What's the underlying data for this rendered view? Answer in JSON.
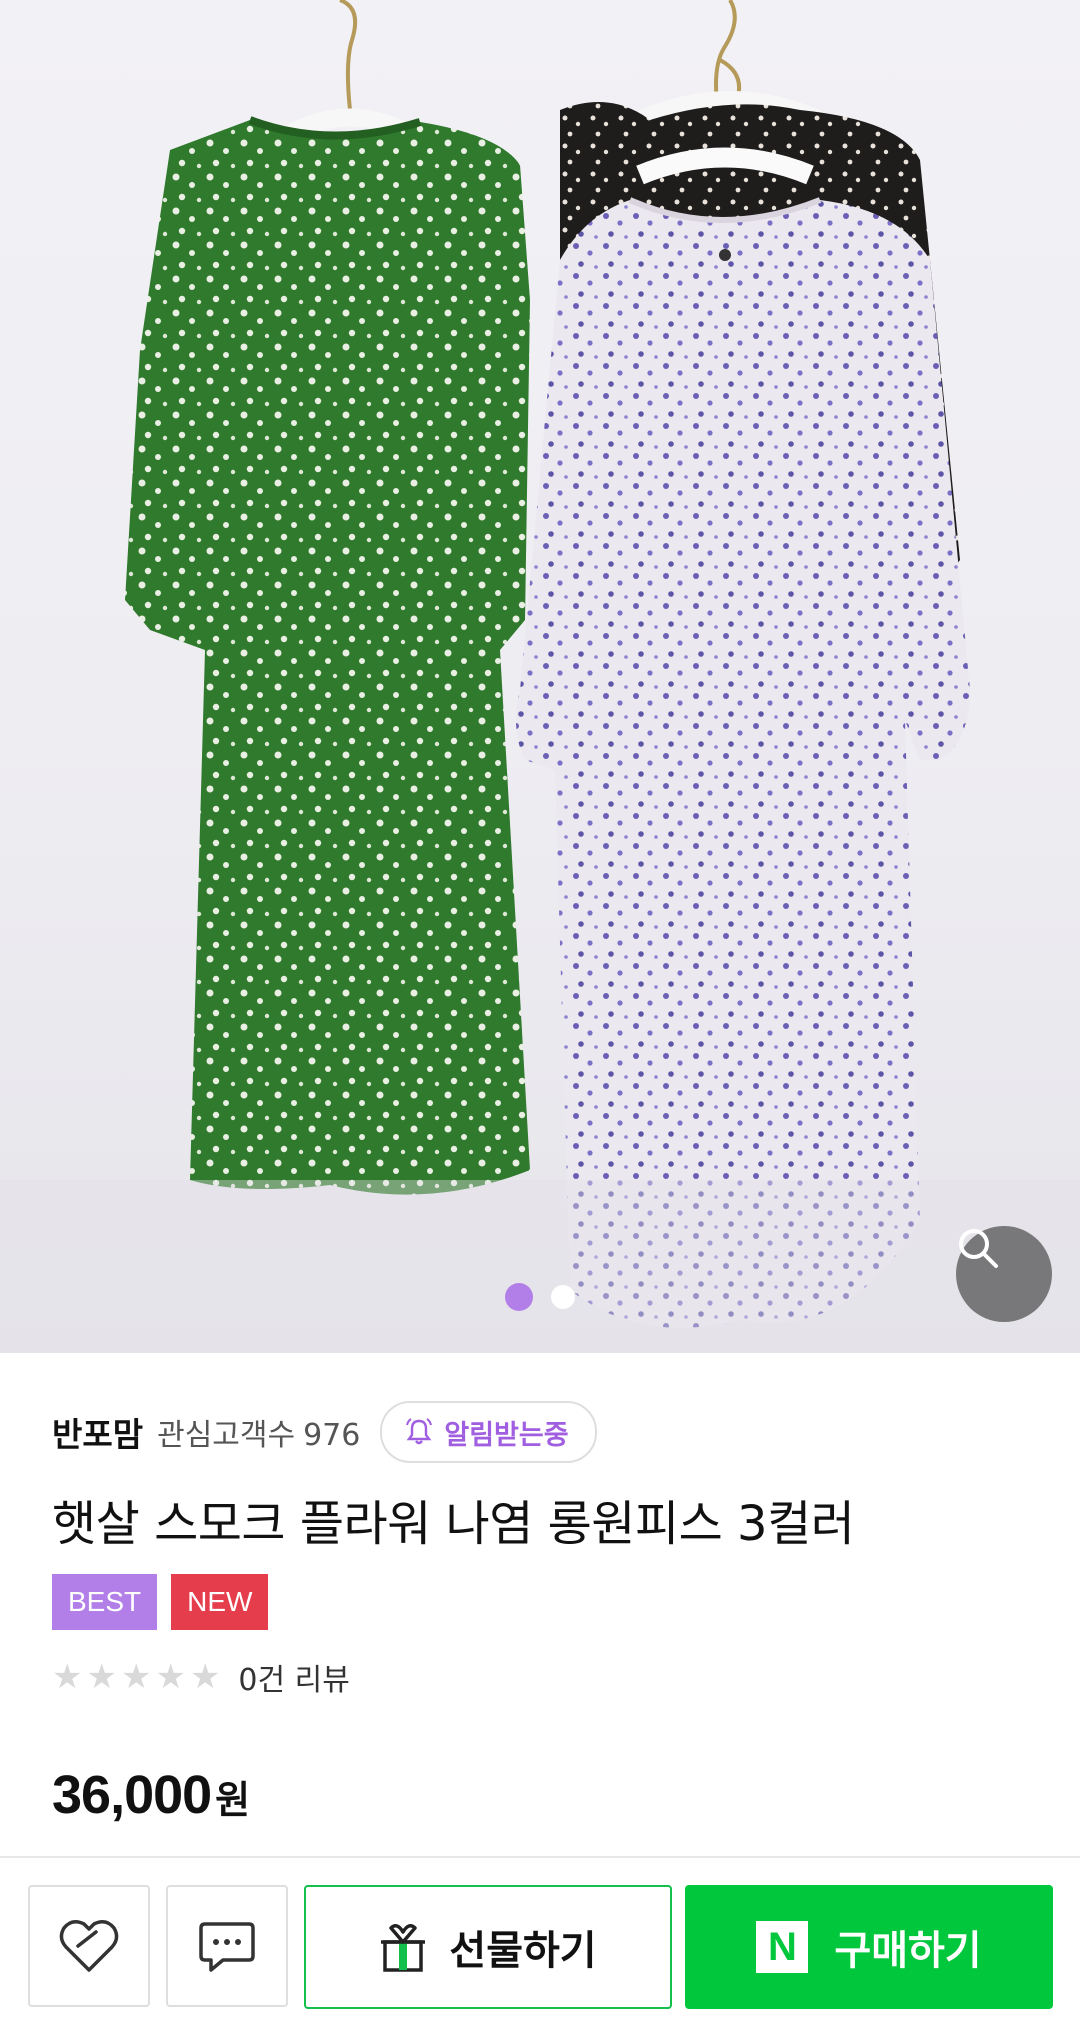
{
  "product_image": {
    "zoom_icon": "search-icon",
    "page_indicator": {
      "total": 2,
      "current": 1
    }
  },
  "seller": {
    "name": "반포맘",
    "followers_label": "관심고객수",
    "followers_count": "976",
    "alert_label": "알림받는중",
    "alert_icon": "bell-icon"
  },
  "product": {
    "title": "햇살 스모크 플라워 나염 롱원피스 3컬러",
    "badges": [
      {
        "label": "BEST",
        "color": "#b27ee8"
      },
      {
        "label": "NEW",
        "color": "#e53d4c"
      }
    ],
    "rating": {
      "stars": 0,
      "max": 5
    },
    "review_text": "0건 리뷰",
    "price": "36,000",
    "currency": "원"
  },
  "actions": {
    "like_icon": "heart-icon",
    "chat_icon": "chat-icon",
    "gift_label": "선물하기",
    "gift_icon": "gift-icon",
    "buy_label": "구매하기",
    "buy_logo": "N",
    "buy_color": "#00c73c"
  }
}
